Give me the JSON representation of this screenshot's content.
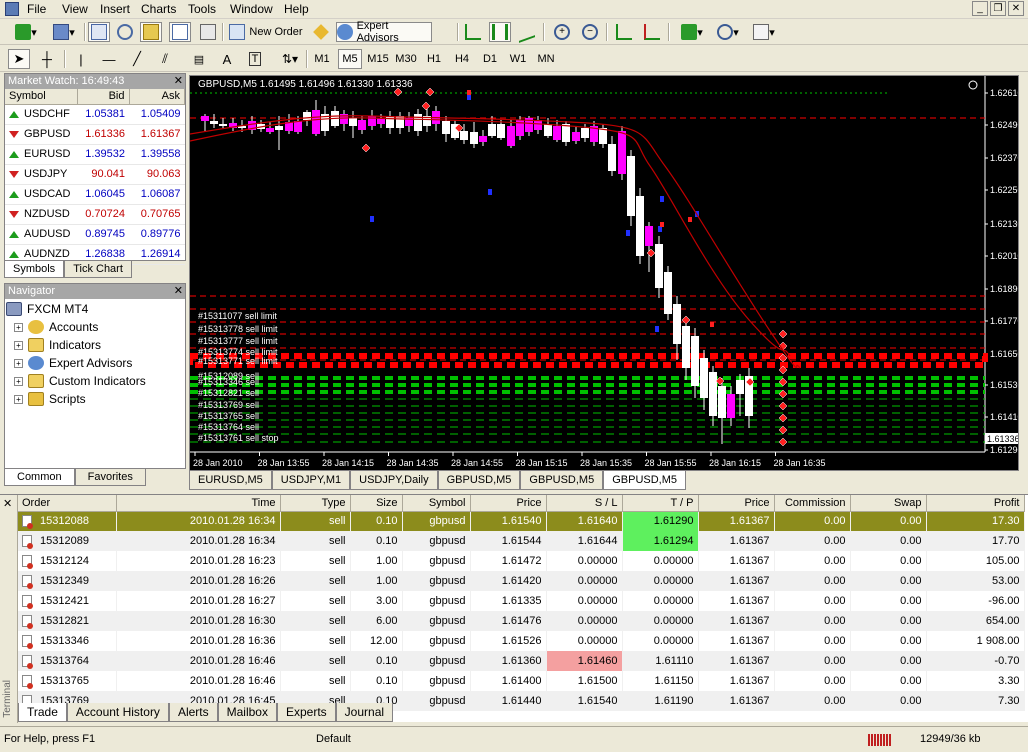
{
  "menu": [
    "File",
    "View",
    "Insert",
    "Charts",
    "Tools",
    "Window",
    "Help"
  ],
  "toolbar": {
    "new_order": "New Order",
    "expert_advisors": "Expert Advisors",
    "timeframes": [
      "M1",
      "M5",
      "M15",
      "M30",
      "H1",
      "H4",
      "D1",
      "W1",
      "MN"
    ],
    "active_timeframe": "M5"
  },
  "market_watch": {
    "title": "Market Watch: 16:49:43",
    "columns": [
      "Symbol",
      "Bid",
      "Ask"
    ],
    "rows": [
      {
        "symbol": "USDCHF",
        "bid": "1.05381",
        "ask": "1.05409",
        "dir": "up"
      },
      {
        "symbol": "GBPUSD",
        "bid": "1.61336",
        "ask": "1.61367",
        "dir": "down"
      },
      {
        "symbol": "EURUSD",
        "bid": "1.39532",
        "ask": "1.39558",
        "dir": "up"
      },
      {
        "symbol": "USDJPY",
        "bid": "90.041",
        "ask": "90.063",
        "dir": "down"
      },
      {
        "symbol": "USDCAD",
        "bid": "1.06045",
        "ask": "1.06087",
        "dir": "up"
      },
      {
        "symbol": "NZDUSD",
        "bid": "0.70724",
        "ask": "0.70765",
        "dir": "down"
      },
      {
        "symbol": "AUDUSD",
        "bid": "0.89745",
        "ask": "0.89776",
        "dir": "up"
      },
      {
        "symbol": "AUDNZD",
        "bid": "1.26838",
        "ask": "1.26914",
        "dir": "up"
      }
    ],
    "tabs": [
      "Symbols",
      "Tick Chart"
    ]
  },
  "navigator": {
    "title": "Navigator",
    "root": "FXCM MT4",
    "items": [
      "Accounts",
      "Indicators",
      "Expert Advisors",
      "Custom Indicators",
      "Scripts"
    ],
    "tabs": [
      "Common",
      "Favorites"
    ]
  },
  "chart": {
    "title": "GBPUSD,M5  1.61495 1.61496 1.61330 1.61336",
    "price_labels": [
      "1.62610",
      "1.62490",
      "1.62370",
      "1.62250",
      "1.62130",
      "1.62010",
      "1.61890",
      "1.61770",
      "1.61650",
      "1.61530",
      "1.61410",
      "1.61336",
      "1.61290"
    ],
    "current_price": "1.61336",
    "time_labels": [
      "28 Jan 2010",
      "28 Jan 13:55",
      "28 Jan 14:15",
      "28 Jan 14:35",
      "28 Jan 14:55",
      "28 Jan 15:15",
      "28 Jan 15:35",
      "28 Jan 15:55",
      "28 Jan 16:15",
      "28 Jan 16:35"
    ],
    "order_labels": [
      "#15311077 sell limit",
      "#15313778 sell limit",
      "#15313777 sell limit",
      "#15313774 sell limit",
      "#15313771 sell limit",
      "#15312089 sell",
      "#15313346 sell",
      "#15312821 sell",
      "#15313769 sell",
      "#15313765 sell",
      "#15313764 sell",
      "#15313761 sell stop"
    ],
    "tabs": [
      "EURUSD,M5",
      "USDJPY,M1",
      "USDJPY,Daily",
      "GBPUSD,M5",
      "GBPUSD,M5",
      "GBPUSD,M5"
    ]
  },
  "terminal": {
    "columns": [
      "Order",
      "Time",
      "Type",
      "Size",
      "Symbol",
      "Price",
      "S / L",
      "T / P",
      "Price",
      "Commission",
      "Swap",
      "Profit"
    ],
    "rows": [
      [
        "15312088",
        "2010.01.28 16:34",
        "sell",
        "0.10",
        "gbpusd",
        "1.61540",
        "1.61640",
        "1.61290",
        "1.61367",
        "0.00",
        "0.00",
        "17.30"
      ],
      [
        "15312089",
        "2010.01.28 16:34",
        "sell",
        "0.10",
        "gbpusd",
        "1.61544",
        "1.61644",
        "1.61294",
        "1.61367",
        "0.00",
        "0.00",
        "17.70"
      ],
      [
        "15312124",
        "2010.01.28 16:23",
        "sell",
        "1.00",
        "gbpusd",
        "1.61472",
        "0.00000",
        "0.00000",
        "1.61367",
        "0.00",
        "0.00",
        "105.00"
      ],
      [
        "15312349",
        "2010.01.28 16:26",
        "sell",
        "1.00",
        "gbpusd",
        "1.61420",
        "0.00000",
        "0.00000",
        "1.61367",
        "0.00",
        "0.00",
        "53.00"
      ],
      [
        "15312421",
        "2010.01.28 16:27",
        "sell",
        "3.00",
        "gbpusd",
        "1.61335",
        "0.00000",
        "0.00000",
        "1.61367",
        "0.00",
        "0.00",
        "-96.00"
      ],
      [
        "15312821",
        "2010.01.28 16:30",
        "sell",
        "6.00",
        "gbpusd",
        "1.61476",
        "0.00000",
        "0.00000",
        "1.61367",
        "0.00",
        "0.00",
        "654.00"
      ],
      [
        "15313346",
        "2010.01.28 16:36",
        "sell",
        "12.00",
        "gbpusd",
        "1.61526",
        "0.00000",
        "0.00000",
        "1.61367",
        "0.00",
        "0.00",
        "1 908.00"
      ],
      [
        "15313764",
        "2010.01.28 16:46",
        "sell",
        "0.10",
        "gbpusd",
        "1.61360",
        "1.61460",
        "1.61110",
        "1.61367",
        "0.00",
        "0.00",
        "-0.70"
      ],
      [
        "15313765",
        "2010.01.28 16:46",
        "sell",
        "0.10",
        "gbpusd",
        "1.61400",
        "1.61500",
        "1.61150",
        "1.61367",
        "0.00",
        "0.00",
        "3.30"
      ],
      [
        "15313769",
        "2010.01.28 16:45",
        "sell",
        "0.10",
        "gbpusd",
        "1.61440",
        "1.61540",
        "1.61190",
        "1.61367",
        "0.00",
        "0.00",
        "7.30"
      ]
    ],
    "side_label": "Terminal",
    "tabs": [
      "Trade",
      "Account History",
      "Alerts",
      "Mailbox",
      "Experts",
      "Journal"
    ]
  },
  "status": {
    "help": "For Help, press F1",
    "profile": "Default",
    "traffic": "12949/36 kb"
  },
  "colors": {
    "chart_bg": "#000000",
    "bull_candle": "#ffffff",
    "bear_candle": "#ff00ff",
    "sell_limit_line": "#ff0000",
    "sell_line": "#00c000",
    "ma_line": "#c00000",
    "selected_row": "#8c8c1c",
    "tp_highlight": "#5ef05e",
    "sl_highlight": "#f4a0a0"
  }
}
